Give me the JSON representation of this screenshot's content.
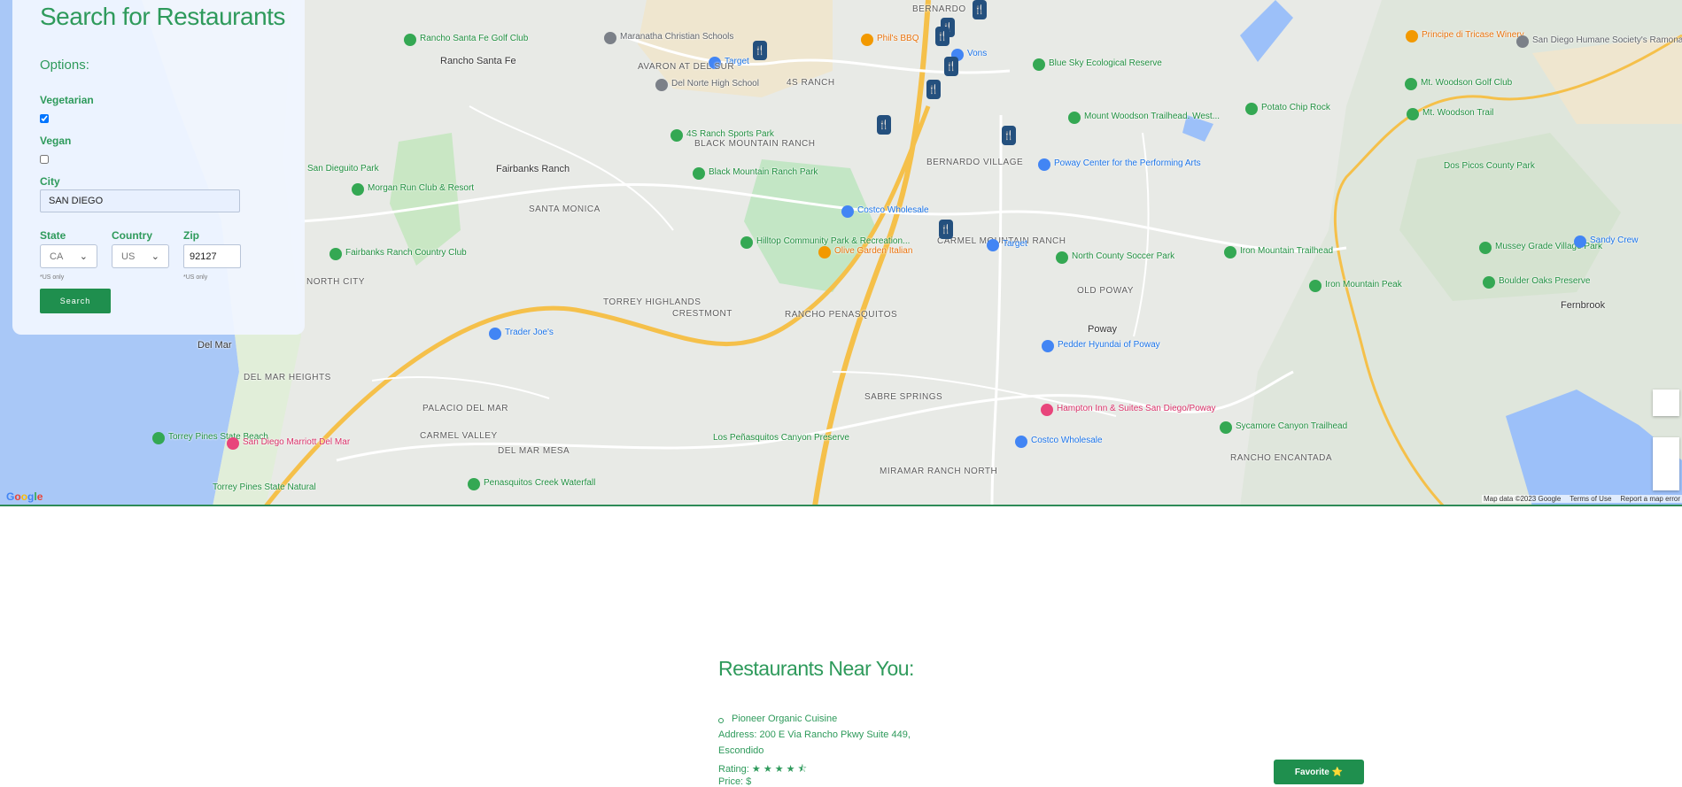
{
  "search_panel": {
    "title": "Search for Restaurants",
    "options_label": "Options:",
    "vegetarian_label": "Vegetarian",
    "vegetarian_checked": true,
    "vegan_label": "Vegan",
    "vegan_checked": false,
    "city_label": "City",
    "city_value": "SAN DIEGO",
    "state_label": "State",
    "state_value": "CA",
    "country_label": "Country",
    "country_value": "US",
    "zip_label": "Zip",
    "zip_value": "92127",
    "us_only_note": "*US only",
    "search_button": "Search"
  },
  "map": {
    "attribution": {
      "map_data": "Map data ©2023 Google",
      "terms": "Terms of Use",
      "report": "Report a map error"
    },
    "logo": "Google",
    "places": [
      {
        "name": "Rancho Santa Fe Golf Club",
        "style": "green",
        "icon": "golf-icon"
      },
      {
        "name": "Rancho Santa Fe",
        "style": "town"
      },
      {
        "name": "Maranatha Christian Schools",
        "style": "gray",
        "icon": "school-icon"
      },
      {
        "name": "Target",
        "style": "blue",
        "icon": "shopping-icon"
      },
      {
        "name": "AVARON AT DEL SUR",
        "style": "area"
      },
      {
        "name": "Del Norte High School",
        "style": "gray",
        "icon": "school-icon"
      },
      {
        "name": "4S RANCH",
        "style": "area"
      },
      {
        "name": "BERNARDO",
        "style": "area"
      },
      {
        "name": "Phil's BBQ",
        "style": "orange",
        "icon": "restaurant-icon"
      },
      {
        "name": "Vons",
        "style": "blue",
        "icon": "shopping-icon"
      },
      {
        "name": "Blue Sky Ecological Reserve",
        "style": "green",
        "icon": "hiking-icon"
      },
      {
        "name": "Principe di Tricase Winery",
        "style": "orange",
        "icon": "winery-icon"
      },
      {
        "name": "San Diego Humane Society's Ramona...",
        "style": "gray",
        "icon": "place-icon"
      },
      {
        "name": "Mt. Woodson Golf Club",
        "style": "green",
        "icon": "golf-icon"
      },
      {
        "name": "Mt. Woodson Trail",
        "style": "green",
        "icon": "hiking-icon"
      },
      {
        "name": "Potato Chip Rock",
        "style": "green",
        "icon": "camera-icon"
      },
      {
        "name": "Mount Woodson Trailhead. West...",
        "style": "green",
        "icon": "hiking-icon"
      },
      {
        "name": "4S Ranch Sports Park",
        "style": "green",
        "icon": "park-icon"
      },
      {
        "name": "BLACK MOUNTAIN RANCH",
        "style": "area"
      },
      {
        "name": "Fairbanks Ranch",
        "style": "town"
      },
      {
        "name": "Black Mountain Ranch Park",
        "style": "green",
        "icon": "park-icon"
      },
      {
        "name": "BERNARDO VILLAGE",
        "style": "area"
      },
      {
        "name": "Poway Center for the Performing Arts",
        "style": "blue",
        "icon": "theater-icon"
      },
      {
        "name": "Dos Picos County Park",
        "style": "green"
      },
      {
        "name": "San Dieguito Park",
        "style": "green"
      },
      {
        "name": "Morgan Run Club & Resort",
        "style": "green",
        "icon": "golf-icon"
      },
      {
        "name": "SANTA MONICA",
        "style": "area"
      },
      {
        "name": "Costco Wholesale",
        "style": "blue",
        "icon": "shopping-icon"
      },
      {
        "name": "Hilltop Community Park & Recreation...",
        "style": "green",
        "icon": "park-icon"
      },
      {
        "name": "Olive Garden Italian",
        "style": "orange",
        "icon": "restaurant-icon"
      },
      {
        "name": "CARMEL MOUNTAIN RANCH",
        "style": "area"
      },
      {
        "name": "Target",
        "style": "blue",
        "icon": "shopping-icon"
      },
      {
        "name": "North County Soccer Park",
        "style": "green",
        "icon": "park-icon"
      },
      {
        "name": "Iron Mountain Trailhead",
        "style": "green",
        "icon": "hiking-icon"
      },
      {
        "name": "Mussey Grade Village Park",
        "style": "green",
        "icon": "park-icon"
      },
      {
        "name": "Sandy Crew",
        "style": "blue",
        "icon": "place-icon"
      },
      {
        "name": "Fairbanks Ranch Country Club",
        "style": "green",
        "icon": "golf-icon"
      },
      {
        "name": "NORTH CITY",
        "style": "area"
      },
      {
        "name": "OLD POWAY",
        "style": "area"
      },
      {
        "name": "Iron Mountain Peak",
        "style": "green",
        "icon": "hiking-icon"
      },
      {
        "name": "Boulder Oaks Preserve",
        "style": "green",
        "icon": "park-icon"
      },
      {
        "name": "Fernbrook",
        "style": "town"
      },
      {
        "name": "TORREY HIGHLANDS",
        "style": "area"
      },
      {
        "name": "CRESTMONT",
        "style": "area"
      },
      {
        "name": "RANCHO PENASQUITOS",
        "style": "area"
      },
      {
        "name": "Poway",
        "style": "town"
      },
      {
        "name": "Trader Joe's",
        "style": "blue",
        "icon": "shopping-icon"
      },
      {
        "name": "Pedder Hyundai of Poway",
        "style": "blue",
        "icon": "car-icon"
      },
      {
        "name": "Del Mar",
        "style": "town"
      },
      {
        "name": "DEL MAR HEIGHTS",
        "style": "area"
      },
      {
        "name": "SABRE SPRINGS",
        "style": "area"
      },
      {
        "name": "Hampton Inn & Suites San Diego/Poway",
        "style": "pink",
        "icon": "hotel-icon"
      },
      {
        "name": "Sycamore Canyon Trailhead",
        "style": "green",
        "icon": "hiking-icon"
      },
      {
        "name": "Torrey Pines State Beach",
        "style": "green",
        "icon": "beach-icon"
      },
      {
        "name": "San Diego Marriott Del Mar",
        "style": "pink",
        "icon": "hotel-icon"
      },
      {
        "name": "PALACIO DEL MAR",
        "style": "area"
      },
      {
        "name": "CARMEL VALLEY",
        "style": "area"
      },
      {
        "name": "DEL MAR MESA",
        "style": "area"
      },
      {
        "name": "Los Peñasquitos Canyon Preserve",
        "style": "green"
      },
      {
        "name": "Costco Wholesale",
        "style": "blue",
        "icon": "shopping-icon"
      },
      {
        "name": "RANCHO ENCANTADA",
        "style": "area"
      },
      {
        "name": "MIRAMAR RANCH NORTH",
        "style": "area"
      },
      {
        "name": "Penasquitos Creek Waterfall",
        "style": "green",
        "icon": "park-icon"
      },
      {
        "name": "Torrey Pines State Natural",
        "style": "green"
      }
    ]
  },
  "results": {
    "title": "Restaurants Near You:",
    "items": [
      {
        "name": "Pioneer Organic Cuisine",
        "address_line1": "Address: 200 E Via Rancho Pkwy Suite 449,",
        "address_line2": "Escondido",
        "rating_label": "Rating:",
        "rating_stars": "★ ★ ★ ★ ⯪",
        "rating_value": 4.5,
        "price": "Price: $",
        "favorite_button": "Favorite ⭐"
      }
    ]
  },
  "colors": {
    "brand_green": "#2e9a5b",
    "button_green": "#1f8f4e",
    "panel_bg": "#f0f5ff",
    "map_water": "#9cc0f9",
    "map_park": "#c3e6c5",
    "highway": "#f5c04a"
  }
}
